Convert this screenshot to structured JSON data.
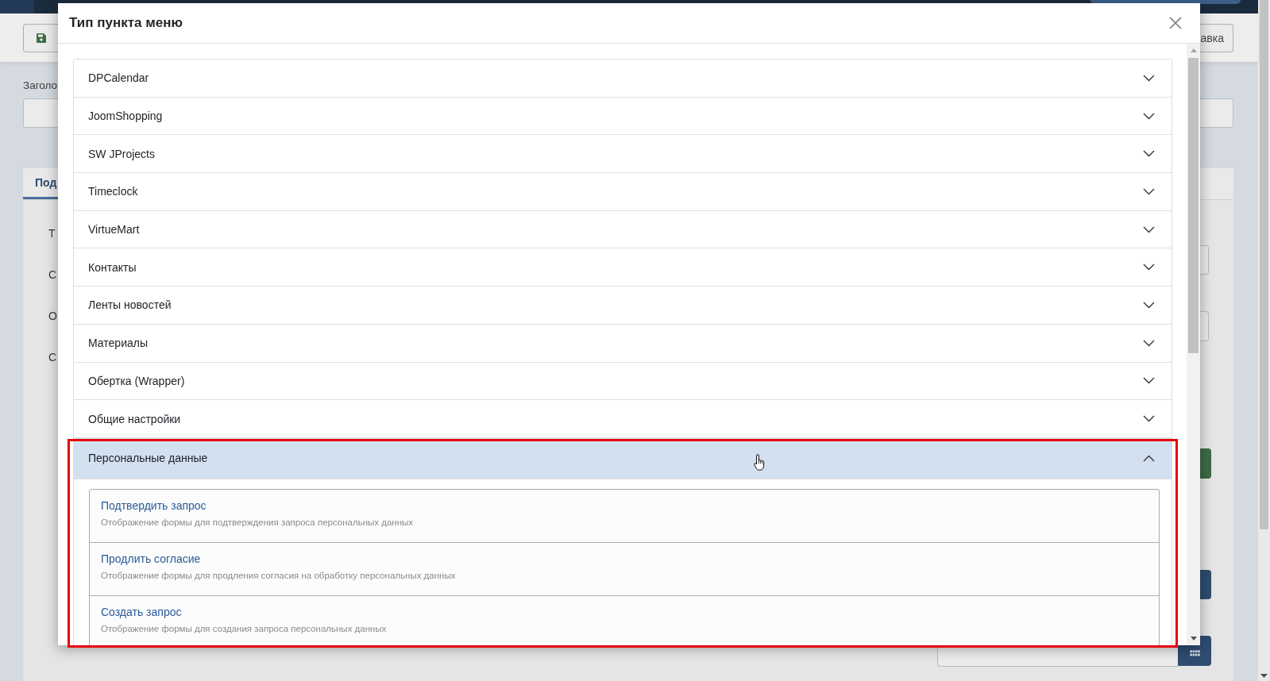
{
  "page_behind": {
    "toolbar_button": "авка",
    "field_label": "Заголо",
    "tab": {
      "label": "Под",
      "selected": true
    },
    "form_labels": [
      "Т",
      "С",
      "О",
      "С"
    ]
  },
  "dialog": {
    "title": "Тип пункта меню",
    "groups": [
      {
        "label": "DPCalendar",
        "expanded": false
      },
      {
        "label": "JoomShopping",
        "expanded": false
      },
      {
        "label": "SW JProjects",
        "expanded": false
      },
      {
        "label": "Timeclock",
        "expanded": false
      },
      {
        "label": "VirtueMart",
        "expanded": false
      },
      {
        "label": "Контакты",
        "expanded": false
      },
      {
        "label": "Ленты новостей",
        "expanded": false
      },
      {
        "label": "Материалы",
        "expanded": false
      },
      {
        "label": "Обертка (Wrapper)",
        "expanded": false
      },
      {
        "label": "Общие настройки",
        "expanded": false
      },
      {
        "label": "Персональные данные",
        "expanded": true,
        "items": [
          {
            "title": "Подтвердить запрос",
            "description": "Отображение формы для подтверждения запроса персональных данных"
          },
          {
            "title": "Продлить согласие",
            "description": "Отображение формы для продления согласия на обработку персональных данных"
          },
          {
            "title": "Создать запрос",
            "description": "Отображение формы для создания запроса персональных данных"
          }
        ]
      }
    ]
  }
}
